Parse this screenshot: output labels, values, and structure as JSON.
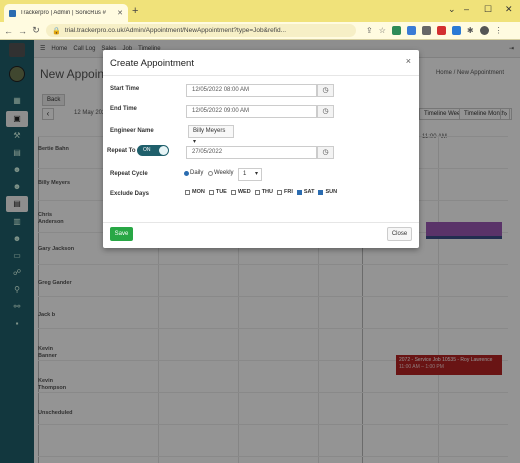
{
  "browser": {
    "tab_title": "Trackerpro | Admin | SonicRus #",
    "url": "trial.trackerpro.co.uk/Admin/Appointment/NewAppointment?type=Job&refid..."
  },
  "topnav": {
    "home": "Home",
    "call_log": "Call Log",
    "sales": "Sales",
    "job": "Job",
    "timeline": "Timeline"
  },
  "page": {
    "title": "New Appoint",
    "breadcrumb": "Home  /  New Appointment",
    "back_label": "Back",
    "date_header": "12 May 202",
    "view_week": "Timeline Week",
    "view_month": "Timeline Month",
    "time_header": "11:00 AM",
    "engineers": [
      "Bertie Bahn",
      "Billy Meyers",
      "Chris Anderson",
      "Gary Jackson",
      "Greg Gander",
      "Jack b",
      "Kevin Banner",
      "Kevin Thompson",
      "Unscheduled"
    ],
    "job_title": "2072 - Service Job 10535 - Roy Lawrence",
    "job_time": "11:00 AM – 1:00 PM"
  },
  "modal": {
    "title": "Create Appointment",
    "start_time_label": "Start Time",
    "start_time_value": "12/05/2022 08:00 AM",
    "end_time_label": "End Time",
    "end_time_value": "12/05/2022 09:00 AM",
    "engineer_label": "Engineer Name",
    "engineer_value": "Billy Meyers",
    "repeat_label": "Repeat To",
    "repeat_toggle": "ON",
    "repeat_date": "27/05/2022",
    "cycle_label": "Repeat Cycle",
    "cycle_daily": "Daily",
    "cycle_weekly": "Weekly",
    "cycle_count": "1",
    "exclude_label": "Exclude Days",
    "days": [
      {
        "label": "MON",
        "checked": false
      },
      {
        "label": "TUE",
        "checked": false
      },
      {
        "label": "WED",
        "checked": false
      },
      {
        "label": "THU",
        "checked": false
      },
      {
        "label": "FRI",
        "checked": false
      },
      {
        "label": "SAT",
        "checked": true
      },
      {
        "label": "SUN",
        "checked": true
      }
    ],
    "save_label": "Save",
    "close_label": "Close"
  },
  "colors": {
    "sidebar": "#1f5f6b",
    "save": "#28a745",
    "job": "#b52424",
    "accent": "#2b6cb0"
  }
}
